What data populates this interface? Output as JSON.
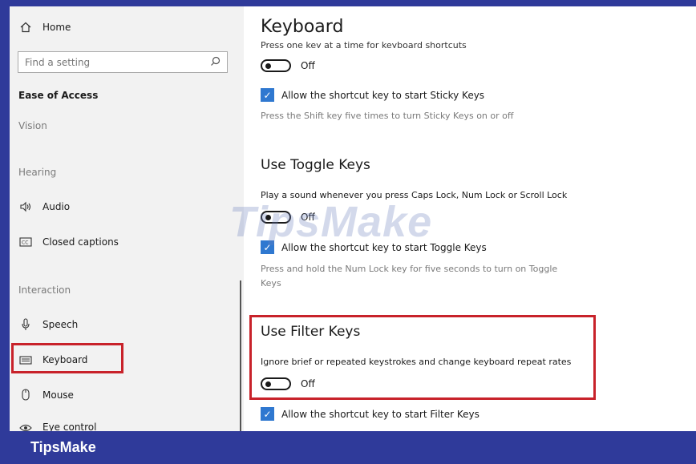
{
  "sidebar": {
    "home_label": "Home",
    "search_placeholder": "Find a setting",
    "category_title": "Ease of Access",
    "sections": {
      "vision": "Vision",
      "hearing": "Hearing",
      "interaction": "Interaction"
    },
    "items": [
      {
        "label": "Audio",
        "icon": "speaker-icon"
      },
      {
        "label": "Closed captions",
        "icon": "captions-icon"
      },
      {
        "label": "Speech",
        "icon": "microphone-icon"
      },
      {
        "label": "Keyboard",
        "icon": "keyboard-icon",
        "selected": true
      },
      {
        "label": "Mouse",
        "icon": "mouse-icon"
      },
      {
        "label": "Eye control",
        "icon": "eye-icon"
      }
    ]
  },
  "main": {
    "title": "Keyboard",
    "sticky_keys": {
      "cut_description": "Press one key at a time for keyboard shortcuts",
      "toggle_state": "Off",
      "shortcut_label": "Allow the shortcut key to start Sticky Keys",
      "shortcut_checked": true,
      "note": "Press the Shift key five times to turn Sticky Keys on or off"
    },
    "toggle_keys": {
      "heading": "Use Toggle Keys",
      "description": "Play a sound whenever you press Caps Lock, Num Lock or Scroll Lock",
      "toggle_state": "Off",
      "shortcut_label": "Allow the shortcut key to start Toggle Keys",
      "shortcut_checked": true,
      "note_line1": "Press and hold the Num Lock key for five seconds to turn on Toggle",
      "note_line2": "Keys"
    },
    "filter_keys": {
      "heading": "Use Filter Keys",
      "description": "Ignore brief or repeated keystrokes and change keyboard repeat rates",
      "toggle_state": "Off",
      "shortcut_label": "Allow the shortcut key to start Filter Keys",
      "shortcut_checked": true
    }
  },
  "watermark": "TipsMake",
  "brand": "TipsMake",
  "colors": {
    "frame": "#2f3a9a",
    "highlight": "#c8222a",
    "checkbox": "#2f78d0",
    "sidebar_bg": "#f2f2f2"
  }
}
